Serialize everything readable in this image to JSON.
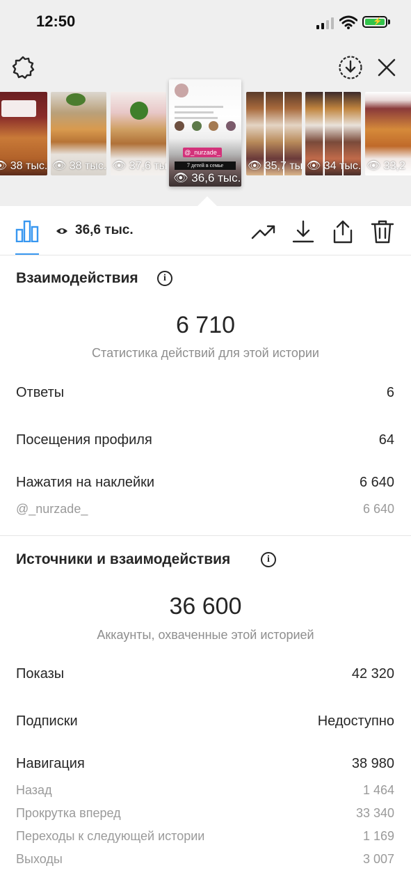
{
  "status": {
    "time": "12:50"
  },
  "stories": [
    {
      "views": "38 тыс."
    },
    {
      "views": "38 тыс."
    },
    {
      "views": "37,6 тыс."
    },
    {
      "views": "36,6 тыс.",
      "selected": true,
      "sticker": "@_nurzade_",
      "caption": "7 детей в семье"
    },
    {
      "views": "35,7 тыс."
    },
    {
      "views": "34 тыс."
    },
    {
      "views": "33,2"
    }
  ],
  "toolbar": {
    "views": "36,6 тыс.",
    "accent": "#3897f0"
  },
  "interactions": {
    "title": "Взаимодействия",
    "total": "6 710",
    "caption": "Статистика действий для этой истории",
    "rows": [
      {
        "label": "Ответы",
        "value": "6"
      },
      {
        "label": "Посещения профиля",
        "value": "64"
      },
      {
        "label": "Нажатия на наклейки",
        "value": "6 640"
      }
    ],
    "sticker_row": {
      "label": "@_nurzade_",
      "value": "6 640"
    }
  },
  "discovery": {
    "title": "Источники и взаимодействия",
    "total": "36 600",
    "caption": "Аккаунты, охваченные этой историей",
    "rows": [
      {
        "label": "Показы",
        "value": "42 320"
      },
      {
        "label": "Подписки",
        "value": "Недоступно"
      },
      {
        "label": "Навигация",
        "value": "38 980"
      }
    ],
    "nav_rows": [
      {
        "label": "Назад",
        "value": "1 464"
      },
      {
        "label": "Прокрутка вперед",
        "value": "33 340"
      },
      {
        "label": "Переходы к следующей истории",
        "value": "1 169"
      },
      {
        "label": "Выходы",
        "value": "3 007"
      }
    ]
  }
}
